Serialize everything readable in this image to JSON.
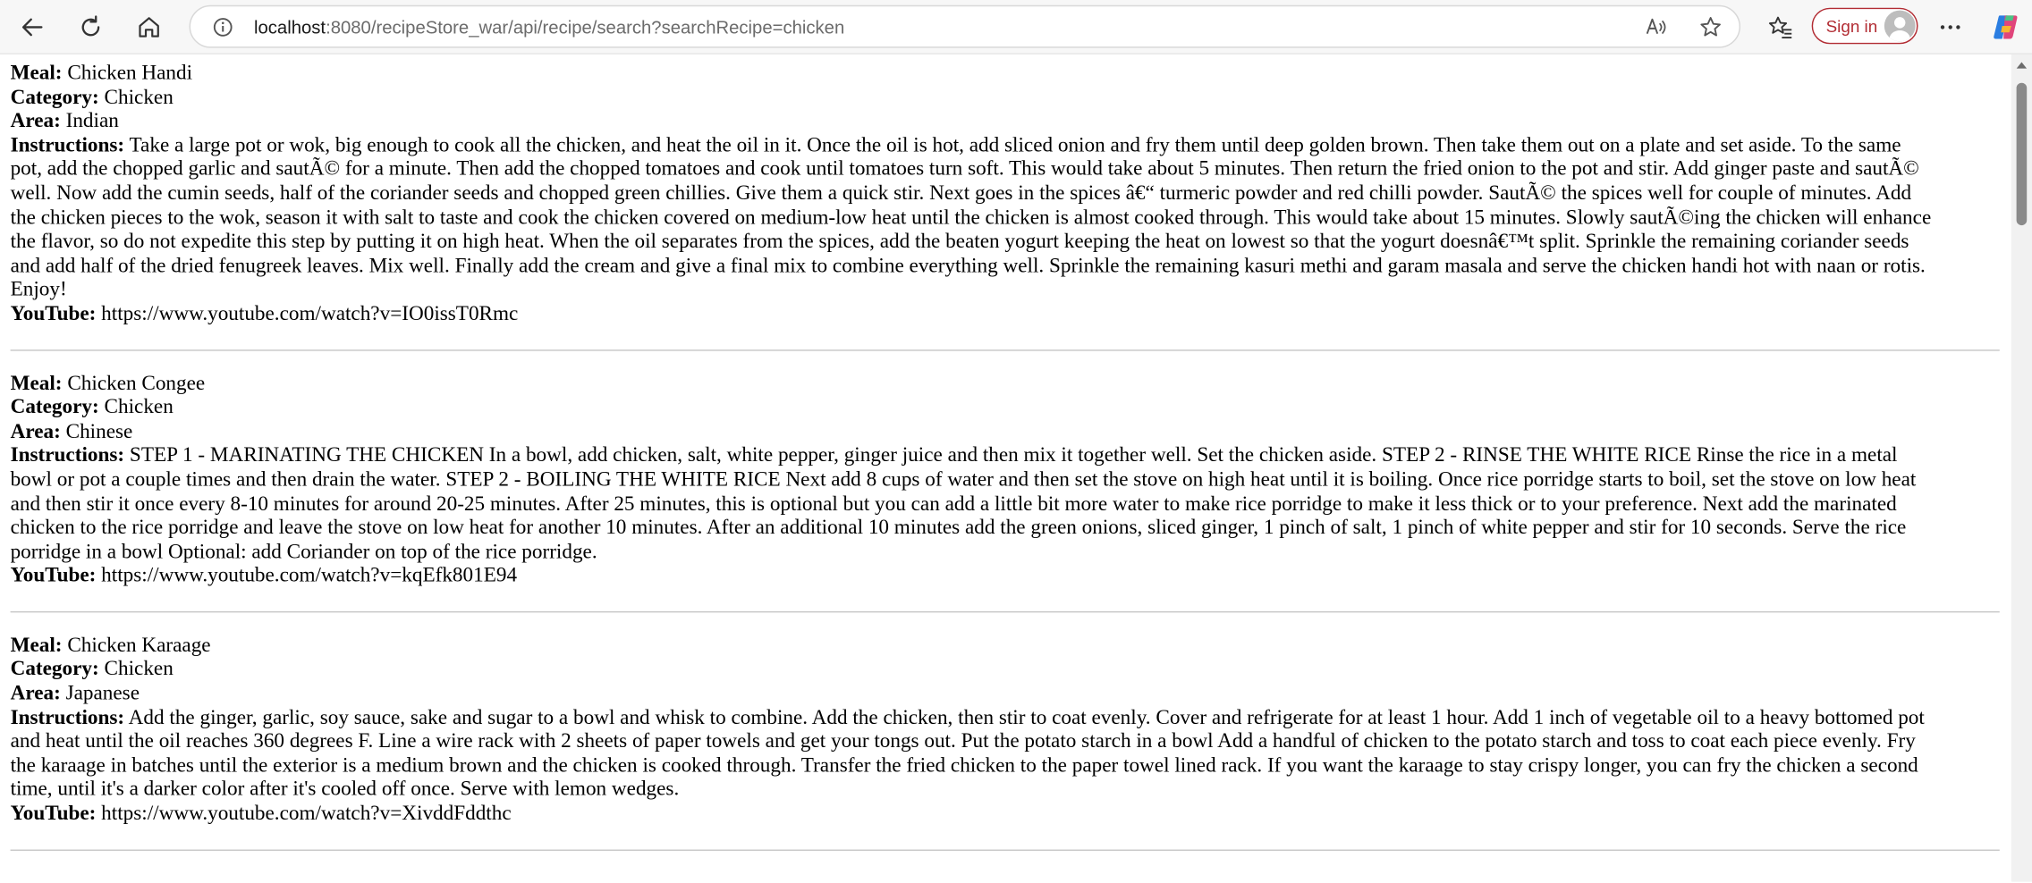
{
  "browser": {
    "url_host": "localhost",
    "url_rest": ":8080/recipeStore_war/api/recipe/search?searchRecipe=chicken",
    "signin_label": "Sign in",
    "icons": {
      "back": "back-arrow-icon",
      "refresh": "refresh-icon",
      "home": "home-icon",
      "site_info": "info-icon",
      "read_aloud": "read-aloud-icon",
      "favorite": "star-icon",
      "favorites": "favorites-icon",
      "avatar": "avatar-icon",
      "menu": "more-icon",
      "copilot": "copilot-icon"
    },
    "accent_color": "#b22d34"
  },
  "labels": {
    "meal": "Meal:",
    "category": "Category:",
    "area": "Area:",
    "instructions": "Instructions:",
    "youtube": "YouTube:"
  },
  "recipes": [
    {
      "meal": "Chicken Handi",
      "category": "Chicken",
      "area": "Indian",
      "instructions_lines": [
        "Take a large pot or wok, big enough to cook all the chicken, and heat the oil in it. Once the oil is hot, add sliced onion and fry them until deep golden brown. Then take them out on a plate and set aside. To the same",
        "pot, add the chopped garlic and sautÃ© for a minute. Then add the chopped tomatoes and cook until tomatoes turn soft. This would take about 5 minutes. Then return the fried onion to the pot and stir. Add ginger paste and sautÃ©",
        "well. Now add the cumin seeds, half of the coriander seeds and chopped green chillies. Give them a quick stir. Next goes in the spices â€“ turmeric powder and red chilli powder. SautÃ© the spices well for couple of minutes. Add",
        "the chicken pieces to the wok, season it with salt to taste and cook the chicken covered on medium-low heat until the chicken is almost cooked through. This would take about 15 minutes. Slowly sautÃ©ing the chicken will enhance",
        "the flavor, so do not expedite this step by putting it on high heat. When the oil separates from the spices, add the beaten yogurt keeping the heat on lowest so that the yogurt doesnâ€™t split. Sprinkle the remaining coriander seeds",
        "and add half of the dried fenugreek leaves. Mix well. Finally add the cream and give a final mix to combine everything well. Sprinkle the remaining kasuri methi and garam masala and serve the chicken handi hot with naan or rotis.",
        "Enjoy!"
      ],
      "youtube": "https://www.youtube.com/watch?v=IO0issT0Rmc"
    },
    {
      "meal": "Chicken Congee",
      "category": "Chicken",
      "area": "Chinese",
      "instructions_lines": [
        "STEP 1 - MARINATING THE CHICKEN In a bowl, add chicken, salt, white pepper, ginger juice and then mix it together well. Set the chicken aside. STEP 2 - RINSE THE WHITE RICE Rinse the rice in a metal",
        "bowl or pot a couple times and then drain the water. STEP 2 - BOILING THE WHITE RICE Next add 8 cups of water and then set the stove on high heat until it is boiling. Once rice porridge starts to boil, set the stove on low heat",
        "and then stir it once every 8-10 minutes for around 20-25 minutes. After 25 minutes, this is optional but you can add a little bit more water to make rice porridge to make it less thick or to your preference. Next add the marinated",
        "chicken to the rice porridge and leave the stove on low heat for another 10 minutes. After an additional 10 minutes add the green onions, sliced ginger, 1 pinch of salt, 1 pinch of white pepper and stir for 10 seconds. Serve the rice",
        "porridge in a bowl Optional: add Coriander on top of the rice porridge."
      ],
      "youtube": "https://www.youtube.com/watch?v=kqEfk801E94"
    },
    {
      "meal": "Chicken Karaage",
      "category": "Chicken",
      "area": "Japanese",
      "instructions_lines": [
        "Add the ginger, garlic, soy sauce, sake and sugar to a bowl and whisk to combine. Add the chicken, then stir to coat evenly. Cover and refrigerate for at least 1 hour. Add 1 inch of vegetable oil to a heavy bottomed pot",
        "and heat until the oil reaches 360 degrees F. Line a wire rack with 2 sheets of paper towels and get your tongs out. Put the potato starch in a bowl Add a handful of chicken to the potato starch and toss to coat each piece evenly. Fry",
        "the karaage in batches until the exterior is a medium brown and the chicken is cooked through. Transfer the fried chicken to the paper towel lined rack. If you want the karaage to stay crispy longer, you can fry the chicken a second",
        "time, until it's a darker color after it's cooled off once. Serve with lemon wedges."
      ],
      "youtube": "https://www.youtube.com/watch?v=XivddFddthc"
    }
  ]
}
